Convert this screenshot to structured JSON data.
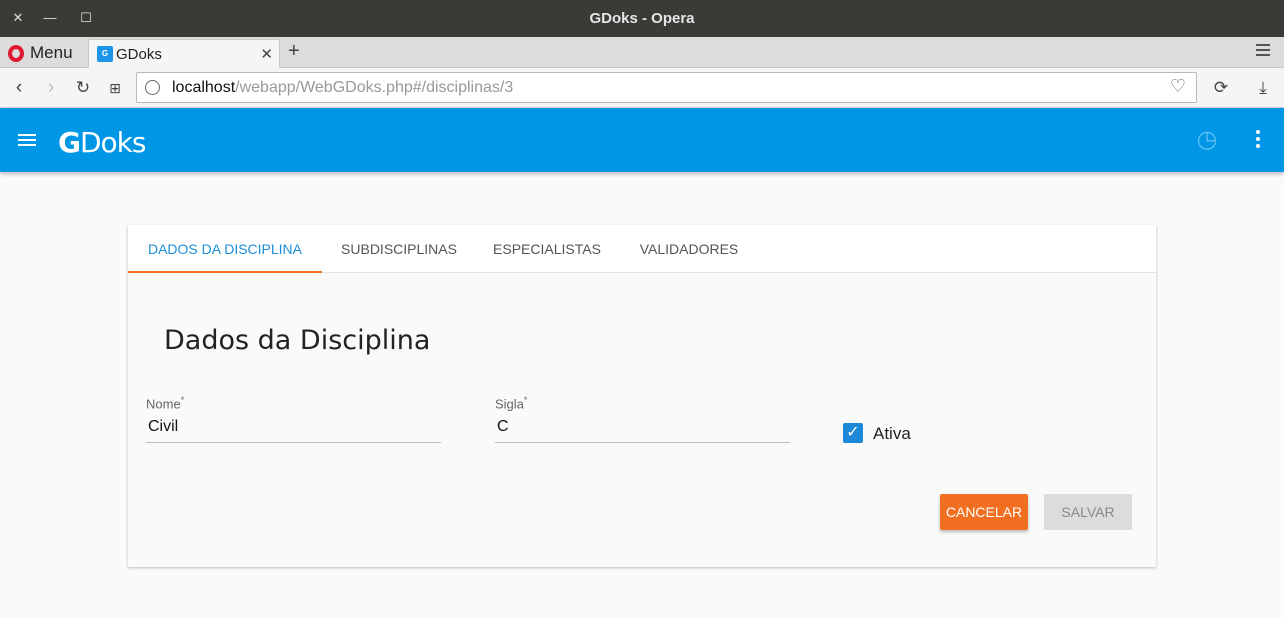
{
  "window": {
    "title": "GDoks - Opera"
  },
  "browser": {
    "menu_label": "Menu",
    "tab_title": "GDoks",
    "new_tab": "+",
    "url_host": "localhost",
    "url_path": "/webapp/WebGDoks.php#/disciplinas/3"
  },
  "app": {
    "logo": "GDoks",
    "logo_g": "G",
    "logo_rest": "Doks"
  },
  "tabs": [
    {
      "label": "DADOS DA DISCIPLINA",
      "active": true
    },
    {
      "label": "SUBDISCIPLINAS"
    },
    {
      "label": "ESPECIALISTAS"
    },
    {
      "label": "VALIDADORES"
    }
  ],
  "form": {
    "title": "Dados da Disciplina",
    "nome_label": "Nome",
    "nome_value": "Civil",
    "sigla_label": "Sigla",
    "sigla_value": "C",
    "required_mark": "*",
    "ativa_label": "Ativa",
    "ativa_checked": true
  },
  "buttons": {
    "cancel": "CANCELAR",
    "save": "SALVAR"
  },
  "colors": {
    "primary": "#0096e6",
    "accent": "#f26f22",
    "tab_active": "#1e8fd8"
  }
}
